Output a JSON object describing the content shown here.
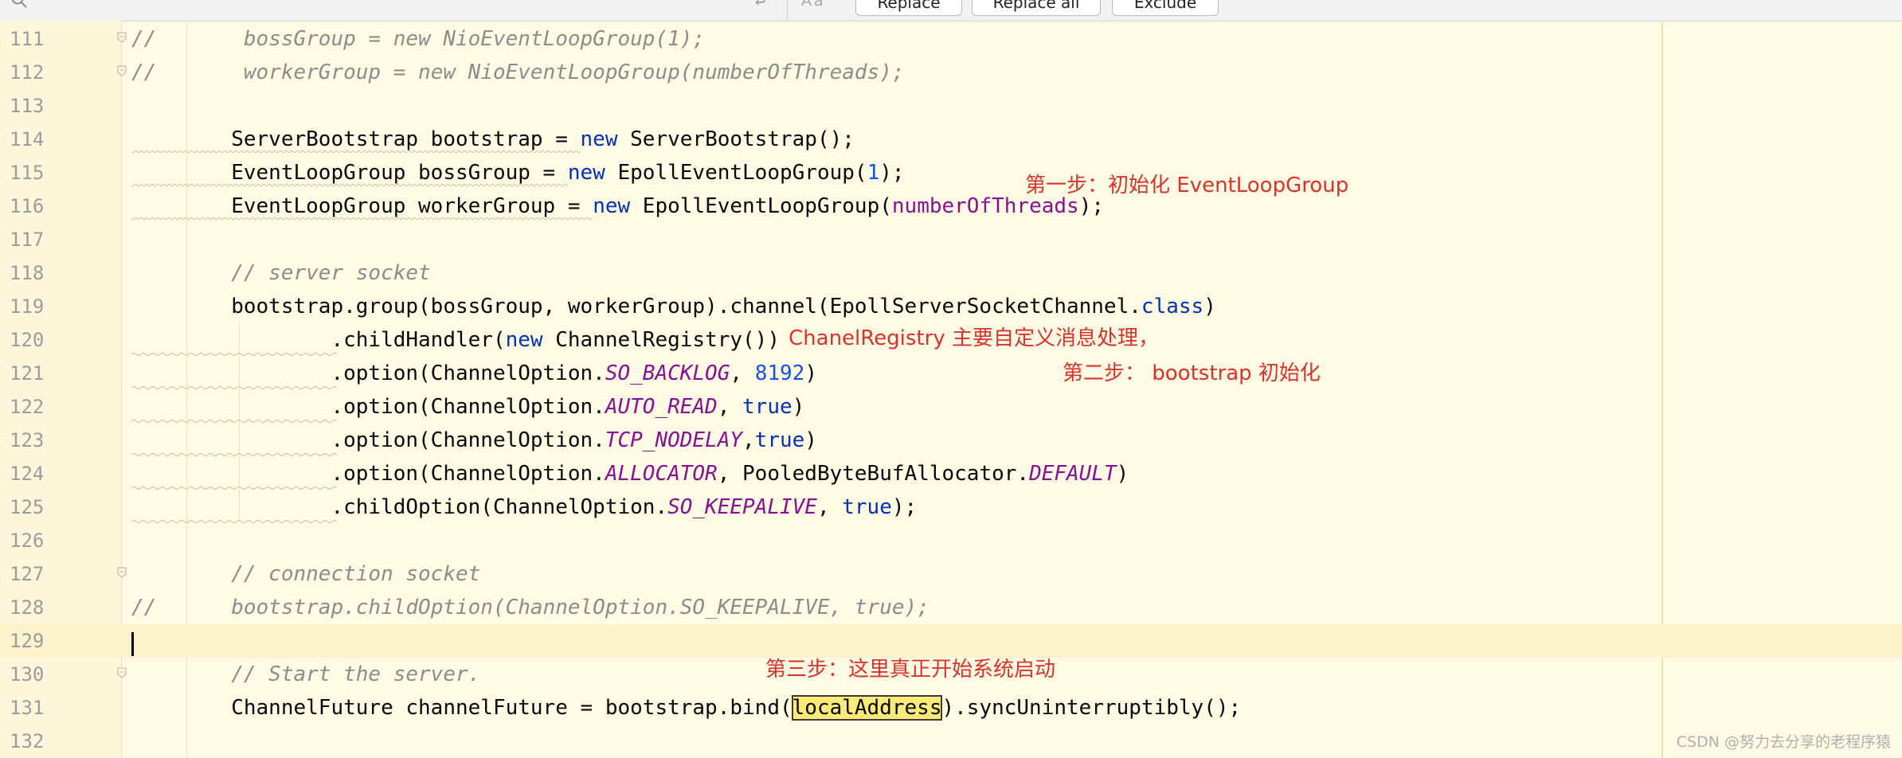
{
  "replace_bar": {
    "replace_label": "Replace",
    "replace_all_label": "Replace all",
    "exclude_label": "Exclude",
    "match_case_glyph": "Aa",
    "regex_toggle_glyph": "↩"
  },
  "editor": {
    "lines": [
      {
        "num": "111",
        "fold": true
      },
      {
        "num": "112",
        "fold": true
      },
      {
        "num": "113"
      },
      {
        "num": "114"
      },
      {
        "num": "115"
      },
      {
        "num": "116"
      },
      {
        "num": "117"
      },
      {
        "num": "118"
      },
      {
        "num": "119"
      },
      {
        "num": "120"
      },
      {
        "num": "121"
      },
      {
        "num": "122"
      },
      {
        "num": "123"
      },
      {
        "num": "124"
      },
      {
        "num": "125"
      },
      {
        "num": "126"
      },
      {
        "num": "127",
        "fold": true
      },
      {
        "num": "128"
      },
      {
        "num": "129",
        "current": true,
        "caret": true
      },
      {
        "num": "130",
        "fold": true
      },
      {
        "num": "131"
      },
      {
        "num": "132"
      }
    ],
    "code": {
      "l111_a": "//       ",
      "l111_b": "bossGroup = new NioEventLoopGroup(1);",
      "l112_a": "//       ",
      "l112_b": "workerGroup = new NioEventLoopGroup(numberOfThreads);",
      "l114_a": "        ServerBootstrap bootstrap = ",
      "l114_kw": "new",
      "l114_b": " ServerBootstrap();",
      "l115_a": "        EventLoopGroup bossGroup = ",
      "l115_kw": "new",
      "l115_b": " EpollEventLoopGroup(",
      "l115_num": "1",
      "l115_c": ");",
      "l116_a": "        EventLoopGroup workerGroup = ",
      "l116_kw": "new",
      "l116_b": " EpollEventLoopGroup(",
      "l116_param": "numberOfThreads",
      "l116_c": ");",
      "l118_cmt": "        // server socket",
      "l119_a": "        bootstrap.group(bossGroup, workerGroup).channel(EpollServerSocketChannel.",
      "l119_kw": "class",
      "l119_b": ")",
      "l120_a": "                .childHandler(",
      "l120_kw": "new",
      "l120_b": " ChannelRegistry())",
      "l121_a": "                .option(ChannelOption.",
      "l121_const": "SO_BACKLOG",
      "l121_b": ", ",
      "l121_num": "8192",
      "l121_c": ")",
      "l122_a": "                .option(ChannelOption.",
      "l122_const": "AUTO_READ",
      "l122_b": ", ",
      "l122_kw": "true",
      "l122_c": ")",
      "l123_a": "                .option(ChannelOption.",
      "l123_const": "TCP_NODELAY",
      "l123_b": ",",
      "l123_kw": "true",
      "l123_c": ")",
      "l124_a": "                .option(ChannelOption.",
      "l124_const": "ALLOCATOR",
      "l124_b": ", PooledByteBufAllocator.",
      "l124_const2": "DEFAULT",
      "l124_c": ")",
      "l125_a": "                .childOption(ChannelOption.",
      "l125_const": "SO_KEEPALIVE",
      "l125_b": ", ",
      "l125_kw": "true",
      "l125_c": ");",
      "l127_cmt": "        // connection socket",
      "l128_a": "//      ",
      "l128_b": "bootstrap.childOption(ChannelOption.SO_KEEPALIVE, true);",
      "l130_cmt": "        // Start the server.",
      "l131_a": "        ChannelFuture channelFuture = bootstrap.bind(",
      "l131_hl": "localAddress",
      "l131_b": ").syncUninterruptibly();"
    }
  },
  "annotations": {
    "step1": "第一步：初始化 EventLoopGroup",
    "registry": "ChanelRegistry 主要自定义消息处理，",
    "step2": "第二步：  bootstrap 初始化",
    "step3": "第三步：这里真正开始系统启动"
  },
  "watermark": "CSDN @努力去分享的老程序猿",
  "colors": {
    "background": "#fffae3",
    "keyword": "#0033b3",
    "number": "#1750eb",
    "field": "#871094",
    "comment": "#8c8c8c",
    "annotation": "#d9342b",
    "highlight": "#fbe978"
  }
}
